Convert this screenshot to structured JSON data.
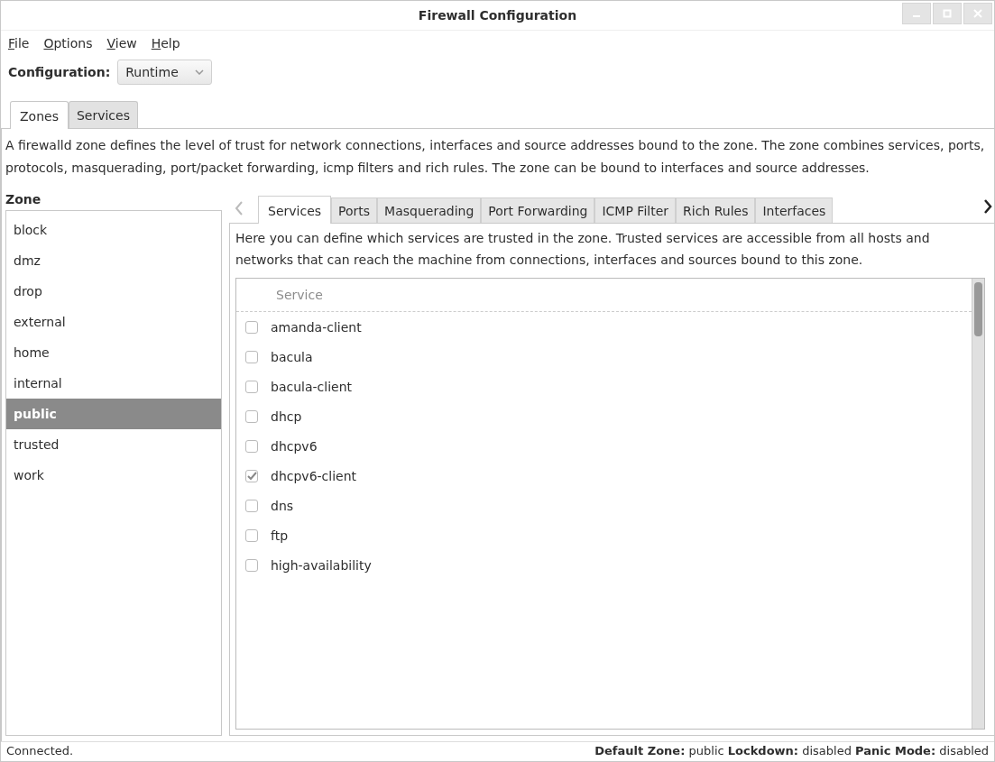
{
  "window": {
    "title": "Firewall Configuration"
  },
  "menu": [
    {
      "label": "File"
    },
    {
      "label": "Options"
    },
    {
      "label": "View"
    },
    {
      "label": "Help"
    }
  ],
  "configuration": {
    "label": "Configuration:",
    "value": "Runtime"
  },
  "tabs": [
    {
      "label": "Zones",
      "selected": true
    },
    {
      "label": "Services",
      "selected": false
    }
  ],
  "zones_description": "A firewalld zone defines the level of trust for network connections, interfaces and source addresses bound to the zone. The zone combines services, ports, protocols, masquerading, port/packet forwarding, icmp filters and rich rules. The zone can be bound to interfaces and source addresses.",
  "zone_list": {
    "title": "Zone",
    "items": [
      {
        "label": "block",
        "selected": false
      },
      {
        "label": "dmz",
        "selected": false
      },
      {
        "label": "drop",
        "selected": false
      },
      {
        "label": "external",
        "selected": false
      },
      {
        "label": "home",
        "selected": false
      },
      {
        "label": "internal",
        "selected": false
      },
      {
        "label": "public",
        "selected": true
      },
      {
        "label": "trusted",
        "selected": false
      },
      {
        "label": "work",
        "selected": false
      }
    ]
  },
  "zone_tabs": [
    {
      "label": "Services",
      "selected": true
    },
    {
      "label": "Ports",
      "selected": false
    },
    {
      "label": "Masquerading",
      "selected": false
    },
    {
      "label": "Port Forwarding",
      "selected": false
    },
    {
      "label": "ICMP Filter",
      "selected": false
    },
    {
      "label": "Rich Rules",
      "selected": false
    },
    {
      "label": "Interfaces",
      "selected": false
    }
  ],
  "services_description": "Here you can define which services are trusted in the zone. Trusted services are accessible from all hosts and networks that can reach the machine from connections, interfaces and sources bound to this zone.",
  "services_table": {
    "columns": [
      "Service"
    ],
    "rows": [
      {
        "name": "amanda-client",
        "checked": false
      },
      {
        "name": "bacula",
        "checked": false
      },
      {
        "name": "bacula-client",
        "checked": false
      },
      {
        "name": "dhcp",
        "checked": false
      },
      {
        "name": "dhcpv6",
        "checked": false
      },
      {
        "name": "dhcpv6-client",
        "checked": true
      },
      {
        "name": "dns",
        "checked": false
      },
      {
        "name": "ftp",
        "checked": false
      },
      {
        "name": "high-availability",
        "checked": false
      }
    ]
  },
  "status_bar": {
    "connection": "Connected.",
    "summary": "**Default Zone:** public **Lockdown:** disabled **Panic Mode:** disabled"
  }
}
